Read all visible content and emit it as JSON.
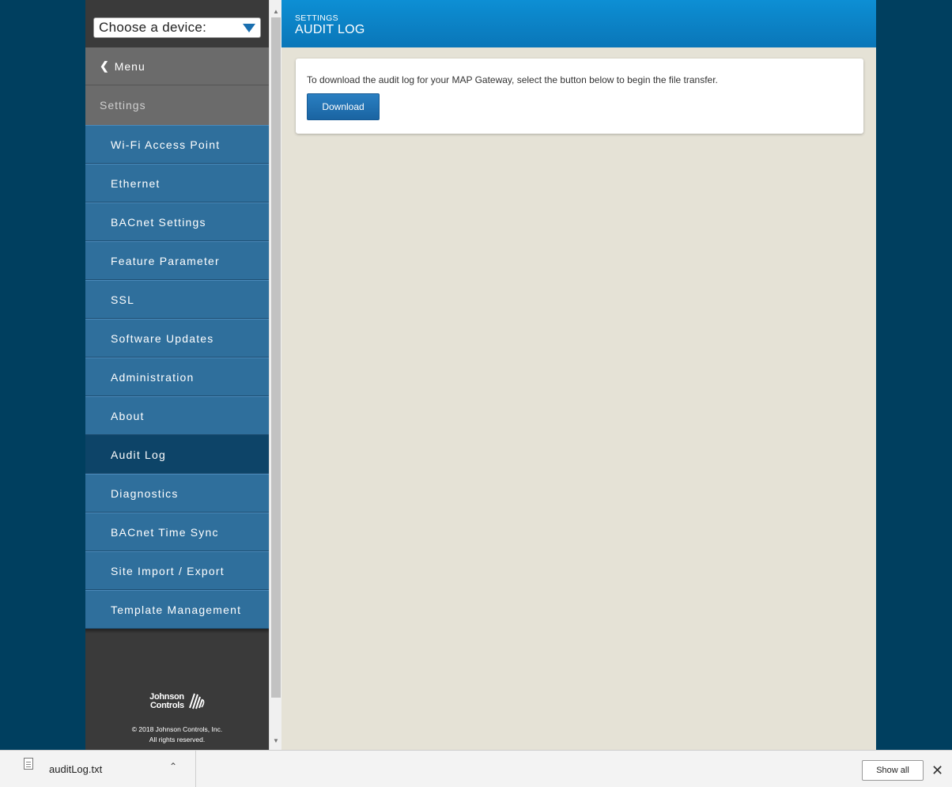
{
  "device_select": {
    "label": "Choose a device:"
  },
  "sidebar": {
    "menu_label": "Menu",
    "section_label": "Settings",
    "items": [
      {
        "label": "Wi-Fi Access Point"
      },
      {
        "label": "Ethernet"
      },
      {
        "label": "BACnet Settings"
      },
      {
        "label": "Feature Parameter"
      },
      {
        "label": "SSL"
      },
      {
        "label": "Software Updates"
      },
      {
        "label": "Administration"
      },
      {
        "label": "About"
      },
      {
        "label": "Audit Log",
        "active": true
      },
      {
        "label": "Diagnostics"
      },
      {
        "label": "BACnet Time Sync"
      },
      {
        "label": "Site Import / Export"
      },
      {
        "label": "Template Management"
      }
    ],
    "footer": {
      "logo_line1": "Johnson",
      "logo_line2": "Controls",
      "copyright_line1": "© 2018 Johnson Controls, Inc.",
      "copyright_line2": "All rights reserved."
    }
  },
  "main": {
    "breadcrumb": "SETTINGS",
    "title": "AUDIT LOG",
    "card_text": "To download the audit log for your MAP Gateway, select the button below to begin the file transfer.",
    "download_label": "Download"
  },
  "download_bar": {
    "file_name": "auditLog.txt",
    "show_all_label": "Show all"
  },
  "colors": {
    "page_bg": "#003f5f",
    "nav_item": "#2f6f9c",
    "nav_active": "#0d4468",
    "header_blue": "#0d8fd4",
    "main_bg": "#e5e2d6"
  },
  "icons": [
    "dropdown-triangle-icon",
    "chevron-left-icon",
    "johnson-controls-logo-icon",
    "file-icon",
    "caret-up-icon",
    "close-icon"
  ]
}
